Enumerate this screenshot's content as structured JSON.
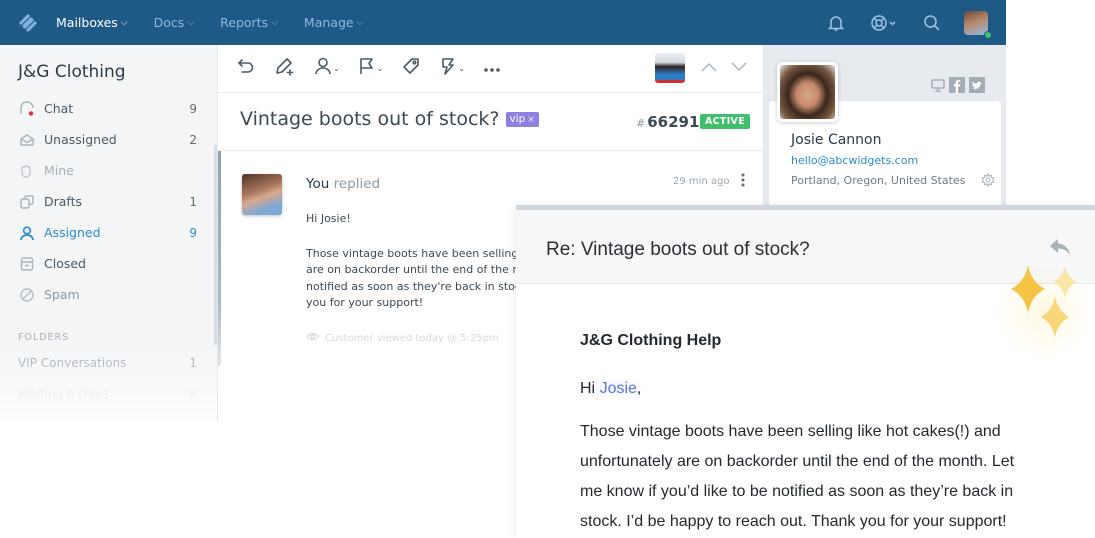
{
  "topnav": {
    "logo_icon": "helpscout-logo-icon",
    "items": [
      {
        "label": "Mailboxes",
        "active": true
      },
      {
        "label": "Docs",
        "active": false
      },
      {
        "label": "Reports",
        "active": false
      },
      {
        "label": "Manage",
        "active": false
      }
    ],
    "right_icons": [
      "bell-icon",
      "lifebuoy-icon",
      "search-icon",
      "user-avatar"
    ],
    "colors": {
      "bar": "#1f5a87",
      "active": "#ffffff",
      "inactive": "#8fb7da",
      "online": "#3fbf6b"
    }
  },
  "sidebar": {
    "title": "J&G Clothing",
    "items": [
      {
        "label": "Chat",
        "count": "9",
        "icon": "chat-icon",
        "state": "normal"
      },
      {
        "label": "Unassigned",
        "count": "2",
        "icon": "inbox-icon",
        "state": "normal"
      },
      {
        "label": "Mine",
        "count": "",
        "icon": "hand-icon",
        "state": "dim"
      },
      {
        "label": "Drafts",
        "count": "1",
        "icon": "drafts-icon",
        "state": "normal"
      },
      {
        "label": "Assigned",
        "count": "9",
        "icon": "person-icon",
        "state": "active"
      },
      {
        "label": "Closed",
        "count": "",
        "icon": "archive-icon",
        "state": "normal"
      },
      {
        "label": "Spam",
        "count": "",
        "icon": "spam-icon",
        "state": "normal"
      }
    ],
    "folders_heading": "FOLDERS",
    "folders": [
      {
        "label": "VIP Conversations",
        "count": "1"
      },
      {
        "label": "Waiting 6 Days",
        "count": "9"
      }
    ],
    "active_color": "#2b8cd0"
  },
  "toolbar": {
    "buttons": [
      "undo-icon",
      "edit-note-icon",
      "assign-icon",
      "flag-icon",
      "tag-icon",
      "workflow-icon",
      "more-icon"
    ],
    "nav": [
      "chevron-up-icon",
      "chevron-down-icon"
    ]
  },
  "conversation": {
    "subject": "Vintage boots out of stock?",
    "tag": "vip",
    "tag_remove": "×",
    "number_hash": "#",
    "number": "66291",
    "status": "ACTIVE",
    "colors": {
      "tag": "#8e7fe0",
      "status": "#3fbf6b"
    }
  },
  "message": {
    "author": "You",
    "action": "replied",
    "time": "29 min ago",
    "greeting": "Hi Josie!",
    "body_lines": [
      "Those vintage boots have been selling like hot cakes(!) and unfortunately",
      "are on backorder until the end of the month. Let me know if you'd like to be",
      "notified as soon as they're back in stock. I'd be happy to reach out. Thank",
      "you for your support!"
    ],
    "viewed": "Customer viewed today @ 5:25pm"
  },
  "customer": {
    "name": "Josie Cannon",
    "email": "hello@abcwidgets.com",
    "location": "Portland, Oregon, United States",
    "social": [
      "monitor-icon",
      "facebook-icon",
      "twitter-icon"
    ]
  },
  "email_preview": {
    "subject": "Re: Vintage boots out of stock?",
    "from": "J&G Clothing Help",
    "greeting_prefix": "Hi ",
    "greeting_name": "Josie",
    "greeting_suffix": ",",
    "body_lines": [
      "Those vintage boots have been selling like hot cakes(!) and",
      "unfortunately are on backorder until the end of the month. Let",
      "me know if you’d like to be notified as soon as they’re back in",
      "stock. I’d be happy to reach out. Thank you for your support!"
    ],
    "name_color": "#5a78d6",
    "sparkle_colors": [
      "#f5c445",
      "#fbe6a6",
      "#f9d779"
    ]
  }
}
